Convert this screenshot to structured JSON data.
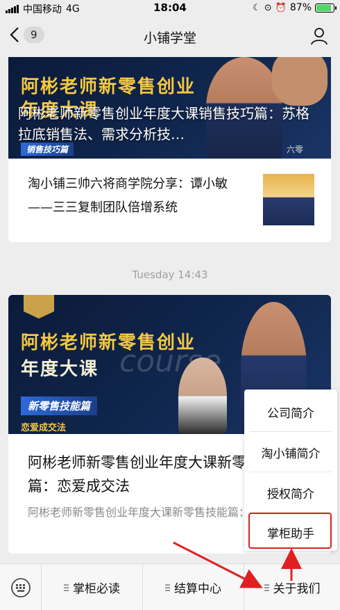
{
  "status": {
    "carrier": "中国移动",
    "network": "4G",
    "time": "18:04",
    "battery": "87%",
    "battery_level": 0.87
  },
  "nav": {
    "back_count": "9",
    "title": "小铺学堂"
  },
  "feed": {
    "card1": {
      "banner_line1": "阿彬老师新零售创业",
      "banner_line2": "年度大课",
      "banner_tag": "销售技巧篇",
      "banner_corner": "六零",
      "overlay_title": "阿彬老师新零售创业年度大课销售技巧篇：苏格拉底销售法、需求分析技…",
      "sub_article": "淘小铺三帅六将商学院分享：谭小敏——三三复制团队倍增系统"
    },
    "timestamp": "Tuesday 14:43",
    "card2": {
      "banner_line1": "阿彬老师新零售创业",
      "banner_line2": "年度大课",
      "banner_course": "course",
      "banner_tag": "新零售技能篇",
      "banner_sub": "恋爱成交法",
      "title": "阿彬老师新零售创业年度大课新零售技能篇：恋爱成交法",
      "desc": "阿彬老师新零售创业年度大课新零售技能篇：恋爱成交法"
    }
  },
  "popup": {
    "items": [
      "公司简介",
      "淘小铺简介",
      "授权简介",
      "掌柜助手"
    ]
  },
  "menubar": {
    "items": [
      "掌柜必读",
      "结算中心",
      "关于我们"
    ]
  },
  "colors": {
    "highlight": "#e02020",
    "banner_gold": "#f5c842"
  }
}
